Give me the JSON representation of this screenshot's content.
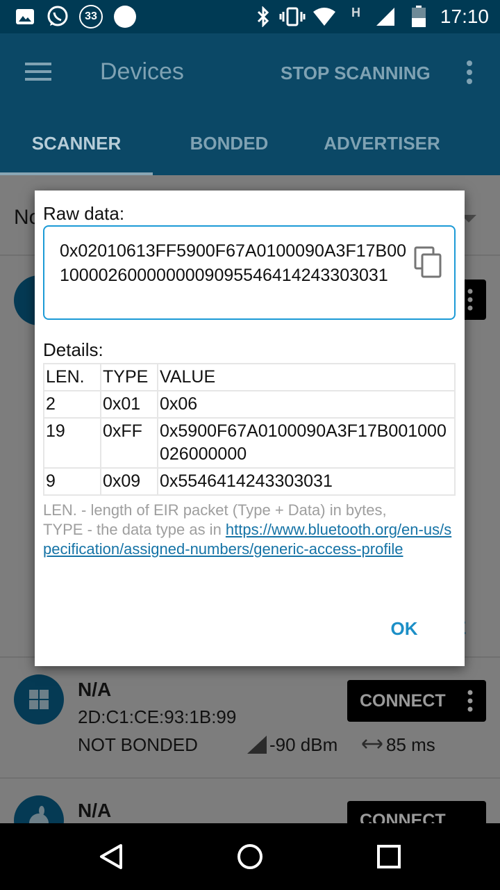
{
  "status_bar": {
    "time": "17:10",
    "notification_count": "33",
    "network_label": "H"
  },
  "app_bar": {
    "title": "Devices",
    "action": "STOP SCANNING"
  },
  "tabs": [
    {
      "label": "SCANNER",
      "active": true
    },
    {
      "label": "BONDED",
      "active": false
    },
    {
      "label": "ADVERTISER",
      "active": false
    }
  ],
  "background": {
    "filter_partial": "No",
    "devices": [
      {
        "name": "N/A",
        "address": "2D:C1:CE:93:1B:99",
        "bond_state": "NOT BONDED",
        "rssi": "-90 dBm",
        "interval": "85 ms",
        "connect_label": "CONNECT"
      },
      {
        "name": "N/A",
        "connect_label": "CONNECT"
      }
    ],
    "hidden_button_fragment": "E"
  },
  "dialog": {
    "raw_label": "Raw data:",
    "raw_value": "0x02010613FF5900F67A0100090A3F17B001000026000000009095546414243303031",
    "details_label": "Details:",
    "table": {
      "headers": [
        "LEN.",
        "TYPE",
        "VALUE"
      ],
      "rows": [
        [
          "2",
          "0x01",
          "0x06"
        ],
        [
          "19",
          "0xFF",
          "0x5900F67A0100090A3F17B001000026000000"
        ],
        [
          "9",
          "0x09",
          "0x5546414243303031"
        ]
      ]
    },
    "legend_line1": "LEN. - length of EIR packet (Type + Data) in bytes,",
    "legend_line2_prefix": "TYPE - the data type as in ",
    "legend_link": "https://www.bluetooth.org/en-us/specification/assigned-numbers/generic-access-profile",
    "ok_label": "OK"
  },
  "colors": {
    "status_bar": "#003a54",
    "app_bar": "#0b4866",
    "scrim_content": "#7d7d7d",
    "accent": "#1c9ad6"
  }
}
